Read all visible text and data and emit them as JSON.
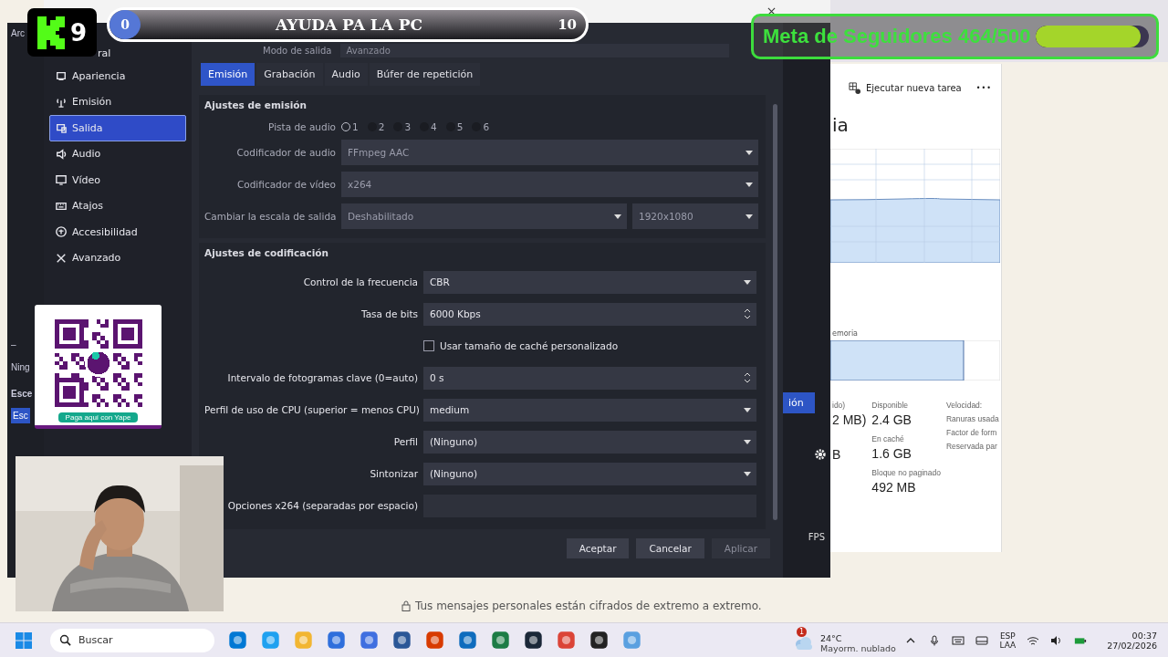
{
  "obs_main": {
    "menu_fragment": "Arc",
    "dash": "–",
    "scene_fragment": "Ning",
    "header_fragment": "Esce",
    "selected_fragment": "Esc",
    "right_button": "ión",
    "fps": "FPS"
  },
  "settings": {
    "output_mode_label": "Modo de salida",
    "output_mode_value": "Avanzado",
    "sidebar": [
      {
        "label": "ral",
        "selected": false
      },
      {
        "label": "Apariencia",
        "selected": false
      },
      {
        "label": "Emisión",
        "selected": false
      },
      {
        "label": "Salida",
        "selected": true
      },
      {
        "label": "Audio",
        "selected": false
      },
      {
        "label": "Vídeo",
        "selected": false
      },
      {
        "label": "Atajos",
        "selected": false
      },
      {
        "label": "Accesibilidad",
        "selected": false
      },
      {
        "label": "Avanzado",
        "selected": false
      }
    ],
    "tabs": [
      {
        "label": "Emisión",
        "selected": true
      },
      {
        "label": "Grabación",
        "selected": false
      },
      {
        "label": "Audio",
        "selected": false
      },
      {
        "label": "Búfer de repetición",
        "selected": false
      }
    ],
    "stream_section": {
      "title": "Ajustes de emisión",
      "track_label": "Pista de audio",
      "tracks": [
        {
          "label": "1",
          "selected": true
        },
        {
          "label": "2",
          "selected": false
        },
        {
          "label": "3",
          "selected": false
        },
        {
          "label": "4",
          "selected": false
        },
        {
          "label": "5",
          "selected": false
        },
        {
          "label": "6",
          "selected": false
        }
      ],
      "rows": [
        {
          "kind": "select",
          "label": "Codificador de audio",
          "value": "FFmpeg AAC"
        },
        {
          "kind": "select",
          "label": "Codificador de vídeo",
          "value": "x264"
        },
        {
          "kind": "double",
          "label": "Cambiar la escala de salida",
          "value": "Deshabilitado",
          "value_2": "1920x1080"
        }
      ]
    },
    "encoding_section": {
      "title": "Ajustes de codificación",
      "rows": [
        {
          "kind": "select",
          "label": "Control de la frecuencia",
          "value": "CBR"
        },
        {
          "kind": "spin",
          "label": "Tasa de bits",
          "value": "6000 Kbps"
        },
        {
          "kind": "checkbox",
          "label": "Usar tamaño de caché personalizado",
          "checked": false
        },
        {
          "kind": "spin",
          "label": "Intervalo de fotogramas clave (0=auto)",
          "value": "0 s"
        },
        {
          "kind": "select",
          "label": "Perfil de uso de CPU (superior = menos CPU)",
          "value": "medium"
        },
        {
          "kind": "select",
          "label": "Perfil",
          "value": "(Ninguno)"
        },
        {
          "kind": "select",
          "label": "Sintonizar",
          "value": "(Ninguno)"
        },
        {
          "kind": "text",
          "label": "Opciones x264 (separadas por espacio)"
        }
      ]
    },
    "buttons": [
      {
        "label": "Aceptar",
        "disabled": false
      },
      {
        "label": "Cancelar",
        "disabled": false
      },
      {
        "label": "Aplicar",
        "disabled": true
      }
    ]
  },
  "task_manager": {
    "action": "Ejecutar nueva tarea",
    "more": "•••",
    "title_fragment": "ia",
    "composition_label": "emoria",
    "stats": [
      {
        "label": "ido)",
        "value": "2 MB)"
      },
      {
        "value": "B"
      },
      {
        "label": "Disponible",
        "value": "2.4 GB"
      },
      {
        "label": "En caché",
        "value": "1.6 GB"
      },
      {
        "label": "Bloque no paginado",
        "value": "492 MB"
      }
    ],
    "specs": [
      "Velocidad:",
      "Ranuras usada",
      "Factor de form",
      "Reservada par"
    ]
  },
  "chat_notice": "Tus mensajes personales están cifrados de extremo a extremo.",
  "overlays": {
    "logo_number": "9",
    "goal_bar": {
      "start": "0",
      "title": "AYUDA PA LA PC",
      "end": "10"
    },
    "follower_goal": {
      "text": "Meta de Seguidores 464/500",
      "level": 0.93
    },
    "qr_caption": "Paga aquí con Yape"
  },
  "taskbar": {
    "search": "Buscar",
    "weather_badge": "1",
    "temperature": "24°C",
    "weather": "Mayorm. nublado",
    "language": "ESP",
    "layout": "LAA",
    "time": "00:37",
    "date": "27/02/2026"
  }
}
